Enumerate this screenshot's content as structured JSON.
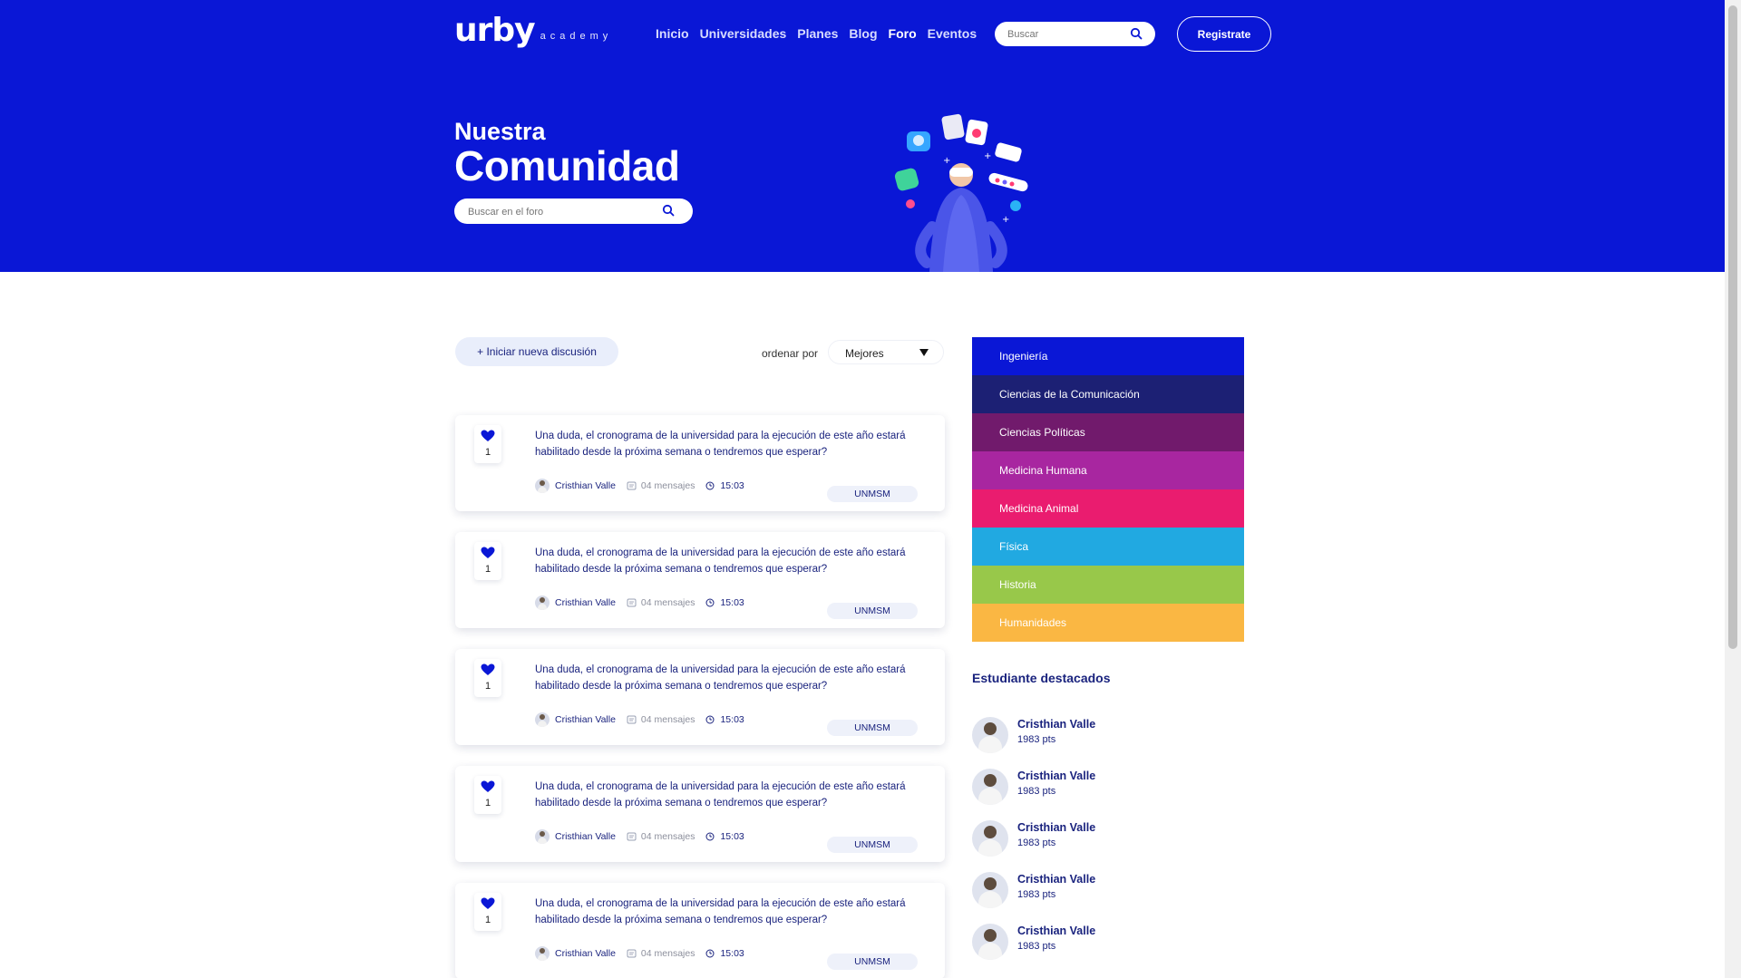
{
  "header": {
    "logo": "urby",
    "logo_sub": "academy",
    "nav": [
      "Inicio",
      "Universidades",
      "Planes",
      "Blog",
      "Foro",
      "Eventos"
    ],
    "active_nav": "Foro",
    "search_placeholder": "Buscar",
    "register_label": "Registrate"
  },
  "hero": {
    "subtitle": "Nuestra",
    "title": "Comunidad",
    "search_placeholder": "Buscar en el foro"
  },
  "toolbar": {
    "new_discussion_label": "+ Iniciar nueva discusión",
    "sort_label": "ordenar por",
    "sort_value": "Mejores"
  },
  "posts": [
    {
      "votes": "1",
      "text": "Una duda, el cronograma de la universidad para la ejecución de este año estará habilitado desde la próxima semana o tendremos que esperar?",
      "author": "Cristhian Valle",
      "messages": "04 mensajes",
      "time": "15:03",
      "badge": "UNMSM"
    },
    {
      "votes": "1",
      "text": "Una duda, el cronograma de la universidad para la ejecución de este año estará habilitado desde la próxima semana o tendremos que esperar?",
      "author": "Cristhian Valle",
      "messages": "04 mensajes",
      "time": "15:03",
      "badge": "UNMSM"
    },
    {
      "votes": "1",
      "text": "Una duda, el cronograma de la universidad para la ejecución de este año estará habilitado desde la próxima semana o tendremos que esperar?",
      "author": "Cristhian Valle",
      "messages": "04 mensajes",
      "time": "15:03",
      "badge": "UNMSM"
    },
    {
      "votes": "1",
      "text": "Una duda, el cronograma de la universidad para la ejecución de este año estará habilitado desde la próxima semana o tendremos que esperar?",
      "author": "Cristhian Valle",
      "messages": "04 mensajes",
      "time": "15:03",
      "badge": "UNMSM"
    },
    {
      "votes": "1",
      "text": "Una duda, el cronograma de la universidad para la ejecución de este año estará habilitado desde la próxima semana o tendremos que esperar?",
      "author": "Cristhian Valle",
      "messages": "04 mensajes",
      "time": "15:03",
      "badge": "UNMSM"
    }
  ],
  "categories": [
    {
      "label": "Ingeniería",
      "color": "#0a17d6"
    },
    {
      "label": "Ciencias de la Comunicación",
      "color": "#1c2074"
    },
    {
      "label": "Ciencias Políticas",
      "color": "#711a6c"
    },
    {
      "label": "Medicina Humana",
      "color": "#a826a0"
    },
    {
      "label": "Medicina Animal",
      "color": "#ea1c6f"
    },
    {
      "label": "Física",
      "color": "#21a9e1"
    },
    {
      "label": "Historia",
      "color": "#98c84a"
    },
    {
      "label": "Humanidades",
      "color": "#fab743"
    }
  ],
  "featured": {
    "title": "Estudiante destacados",
    "students": [
      {
        "name": "Cristhian Valle",
        "points": "1983 pts"
      },
      {
        "name": "Cristhian Valle",
        "points": "1983 pts"
      },
      {
        "name": "Cristhian Valle",
        "points": "1983 pts"
      },
      {
        "name": "Cristhian Valle",
        "points": "1983 pts"
      },
      {
        "name": "Cristhian Valle",
        "points": "1983 pts"
      }
    ]
  },
  "colors": {
    "brand_blue": "#0a17d6",
    "navy_text": "#1a237e"
  }
}
